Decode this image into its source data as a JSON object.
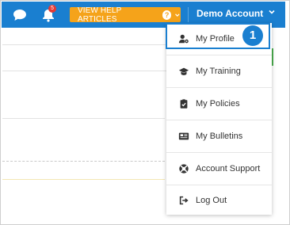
{
  "topbar": {
    "notification_count": "5",
    "help_label": "VIEW HELP ARTICLES",
    "account_label": "Demo Account",
    "icons": {
      "chat": "chat-icon",
      "bell": "bell-icon",
      "help": "question-circle-icon",
      "chevron": "chevron-down-icon"
    }
  },
  "menu": {
    "items": [
      {
        "label": "My Profile",
        "icon": "user-cog-icon"
      },
      {
        "label": "My Training",
        "icon": "graduation-cap-icon"
      },
      {
        "label": "My Policies",
        "icon": "clipboard-check-icon"
      },
      {
        "label": "My Bulletins",
        "icon": "newspaper-icon"
      },
      {
        "label": "Account Support",
        "icon": "lifebuoy-icon"
      },
      {
        "label": "Log Out",
        "icon": "sign-out-icon"
      }
    ],
    "step_marker": "1"
  },
  "colors": {
    "topbar": "#1a7fd0",
    "help_button": "#f5a31a",
    "badge": "#e53935",
    "highlight": "#1a7fd0"
  }
}
